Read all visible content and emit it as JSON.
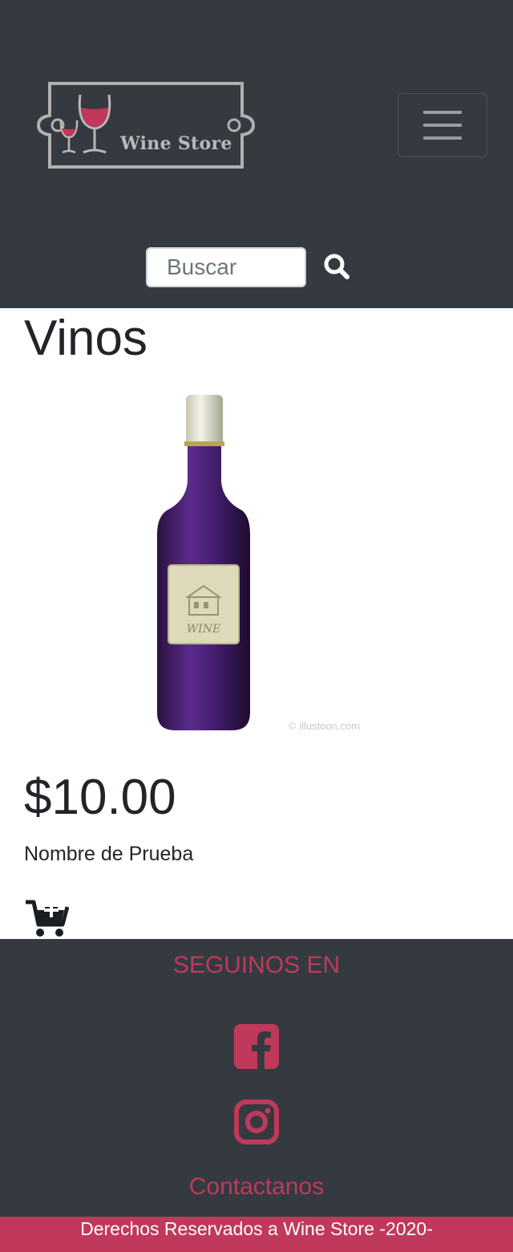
{
  "header": {
    "logo_text": "Wine Store",
    "search": {
      "placeholder": "Buscar",
      "value": ""
    },
    "icons": {
      "menu": "hamburger-menu-icon",
      "search": "magnifier-icon"
    }
  },
  "main": {
    "title": "Vinos",
    "product": {
      "image_watermark": "© illustoon.com",
      "label_text": "WINE",
      "price": "$10.00",
      "name": "Nombre de Prueba",
      "cart_icon": "add-to-cart-icon"
    }
  },
  "footer": {
    "follow_title": "SEGUINOS EN",
    "social_icons": [
      "facebook-icon",
      "instagram-icon"
    ],
    "contact_label": "Contactanos",
    "copyright": "Derechos Reservados a Wine Store -2020-"
  },
  "colors": {
    "navbar_bg": "#343a40",
    "accent": "#c0395a",
    "text": "#212529"
  }
}
